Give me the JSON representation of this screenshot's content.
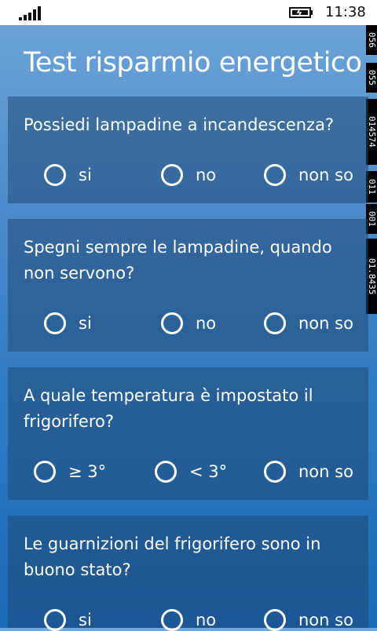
{
  "status": {
    "time": "11:38"
  },
  "title": "Test risparmio energetico",
  "questions": [
    {
      "text": "Possiedi lampadine a incandescenza?",
      "options": [
        "si",
        "no",
        "non so"
      ]
    },
    {
      "text": "Spegni sempre le lampadine, quando non servono?",
      "options": [
        "si",
        "no",
        "non so"
      ]
    },
    {
      "text": "A quale temperatura è impostato il frigorifero?",
      "options": [
        "≥ 3°",
        "< 3°",
        "non so"
      ]
    },
    {
      "text": "Le guarnizioni del frigorifero sono in buono stato?",
      "options": [
        "si",
        "no",
        "non so"
      ]
    }
  ],
  "debug_counters": [
    "056",
    "055",
    "014574",
    "011",
    "001",
    "01.8435"
  ],
  "colors": {
    "background_top": "#6fa6d9",
    "background_bottom": "#1a6ab6",
    "card": "#2e5f8f",
    "text": "#ffffff"
  }
}
